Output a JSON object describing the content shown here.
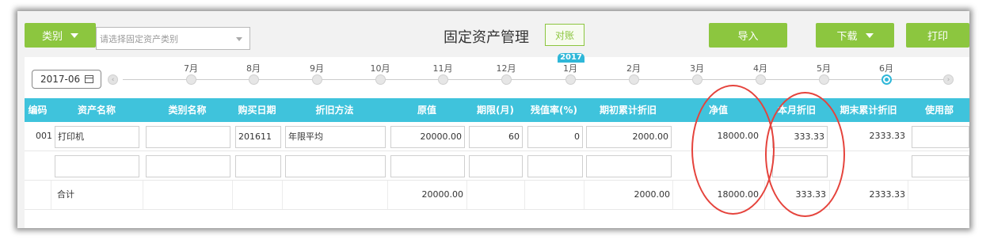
{
  "toolbar": {
    "category_label": "类别",
    "category_placeholder": "请选择固定资产类别",
    "title": "固定资产管理",
    "reconcile_label": "对账",
    "import_label": "导入",
    "download_label": "下载",
    "print_label": "打印"
  },
  "timeline": {
    "period": "2017-06",
    "year_badge": "2017",
    "months": [
      "7月",
      "8月",
      "9月",
      "10月",
      "11月",
      "12月",
      "1月",
      "2月",
      "3月",
      "4月",
      "5月",
      "6月"
    ],
    "active_month": "6月"
  },
  "table": {
    "columns": [
      "编码",
      "资产名称",
      "类别名称",
      "购买日期",
      "折旧方法",
      "原值",
      "期限(月)",
      "残值率(%)",
      "期初累计折旧",
      "净值",
      "本月折旧",
      "期末累计折旧",
      "使用部"
    ],
    "row": {
      "code": "001",
      "name": "打印机",
      "category": "",
      "purchase_date": "201611",
      "method": "年限平均",
      "original_value": "20000.00",
      "term": "60",
      "residual_rate": "0",
      "opening_depr": "2000.00",
      "net_value": "18000.00",
      "month_depr": "333.33",
      "closing_depr": "2333.33"
    },
    "total": {
      "label": "合计",
      "original_value": "20000.00",
      "opening_depr": "2000.00",
      "net_value": "18000.00",
      "month_depr": "333.33",
      "closing_depr": "2333.33"
    }
  },
  "colors": {
    "accent_green": "#8cc63f",
    "header_cyan": "#3fc3dc",
    "annotation_red": "#e5433c"
  }
}
